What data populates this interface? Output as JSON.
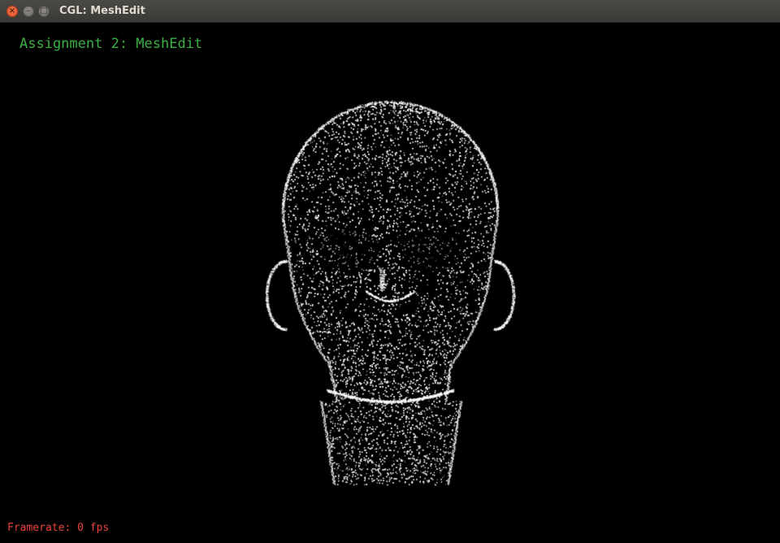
{
  "window": {
    "title": "CGL: MeshEdit",
    "close_glyph": "×",
    "minimize_glyph": "–",
    "maximize_glyph": "□"
  },
  "overlay": {
    "title": "Assignment 2: MeshEdit",
    "framerate": "Framerate: 0 fps"
  },
  "colors": {
    "title_text": "#3bb043",
    "framerate_text": "#e8413a",
    "points": "#ffffff",
    "background": "#000000"
  },
  "icons": {
    "close": "close-icon",
    "minimize": "minimize-icon",
    "maximize": "maximize-icon"
  },
  "scene": {
    "render_mode": "point-cloud",
    "model": "head"
  }
}
